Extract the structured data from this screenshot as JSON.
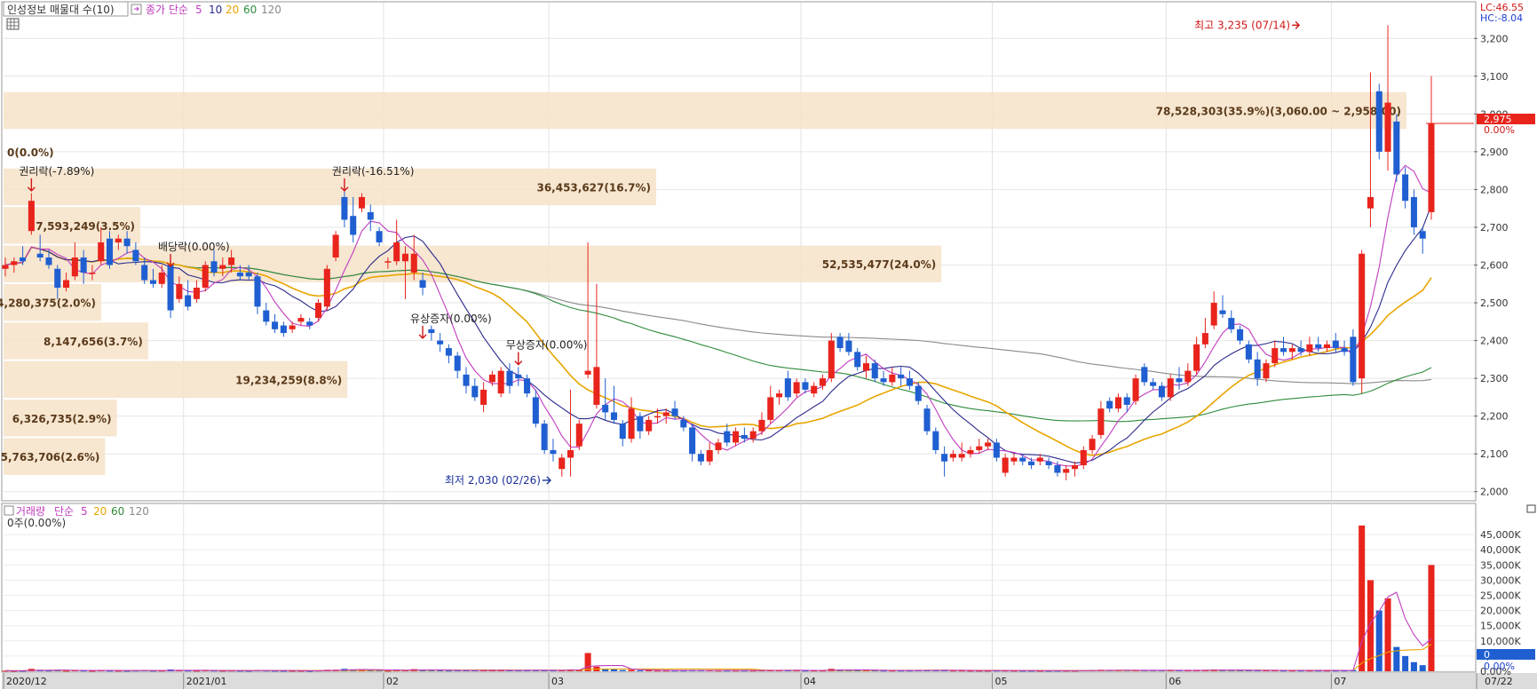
{
  "legend": {
    "title": "인성정보 매물대 수(10)",
    "price_label": "종가 단순",
    "ma_periods": [
      "5",
      "10",
      "20",
      "60",
      "120"
    ],
    "volume_label": "거래량",
    "volume_ma_label": "단순",
    "volume_ma_periods": [
      "5",
      "20",
      "60",
      "120"
    ]
  },
  "colors": {
    "up": "#e8241c",
    "down": "#1f5fd1",
    "ma5": "#c03cc0",
    "ma10": "#2a2a8c",
    "ma20": "#e8a500",
    "ma60": "#2e8b3a",
    "ma120": "#8a8a8a",
    "profile": "#f6e2c8"
  },
  "right_status": {
    "lc": "LC:46.55",
    "hc": "HC:-8.04"
  },
  "current_price_tag": "2,975",
  "current_pct_tag": "0.00%",
  "volume_current_tag": "0",
  "volume_pct_tag": "0.00%",
  "volume_info": "0주(0.00%)",
  "chart_data": {
    "type": "candlestick",
    "price_axis": {
      "ylim": [
        1990,
        3250
      ],
      "ticks": [
        2000,
        2100,
        2200,
        2300,
        2400,
        2500,
        2600,
        2700,
        2800,
        2900,
        3000,
        3100,
        3200
      ],
      "tick_labels": [
        "2,000",
        "2,100",
        "2,200",
        "2,300",
        "2,400",
        "2,500",
        "2,600",
        "2,700",
        "2,800",
        "2,900",
        "3,000",
        "3,100",
        "3,200"
      ]
    },
    "volume_axis": {
      "ylim": [
        0,
        50000
      ],
      "ticks": [
        0,
        5000,
        10000,
        15000,
        20000,
        25000,
        30000,
        35000,
        40000,
        45000
      ],
      "tick_labels": [
        "0.00%",
        "5,000K",
        "10,000K",
        "15,000K",
        "20,000K",
        "25,000K",
        "30,000K",
        "35,000K",
        "40,000K",
        "45,000K"
      ]
    },
    "x_labels": [
      "2020/12",
      "2021/01",
      "02",
      "03",
      "04",
      "05",
      "06",
      "07",
      "07/22"
    ],
    "candles": [
      [
        2590,
        2620,
        2570,
        2600,
        200
      ],
      [
        2600,
        2620,
        2580,
        2610,
        150
      ],
      [
        2620,
        2650,
        2600,
        2610,
        180
      ],
      [
        2690,
        2790,
        2680,
        2770,
        800
      ],
      [
        2630,
        2680,
        2610,
        2620,
        300
      ],
      [
        2620,
        2640,
        2590,
        2600,
        250
      ],
      [
        2590,
        2600,
        2510,
        2540,
        300
      ],
      [
        2540,
        2580,
        2530,
        2560,
        200
      ],
      [
        2570,
        2660,
        2560,
        2620,
        400
      ],
      [
        2620,
        2640,
        2550,
        2580,
        250
      ],
      [
        2580,
        2600,
        2560,
        2580,
        180
      ],
      [
        2610,
        2700,
        2600,
        2660,
        350
      ],
      [
        2670,
        2690,
        2590,
        2600,
        220
      ],
      [
        2660,
        2680,
        2640,
        2670,
        200
      ],
      [
        2670,
        2690,
        2630,
        2650,
        180
      ],
      [
        2640,
        2660,
        2600,
        2610,
        250
      ],
      [
        2600,
        2620,
        2550,
        2560,
        300
      ],
      [
        2560,
        2590,
        2540,
        2550,
        200
      ],
      [
        2550,
        2600,
        2540,
        2580,
        220
      ],
      [
        2600,
        2610,
        2460,
        2480,
        600
      ],
      [
        2510,
        2570,
        2500,
        2550,
        300
      ],
      [
        2520,
        2560,
        2480,
        2490,
        250
      ],
      [
        2510,
        2560,
        2500,
        2540,
        220
      ],
      [
        2540,
        2610,
        2530,
        2600,
        300
      ],
      [
        2610,
        2640,
        2570,
        2580,
        250
      ],
      [
        2590,
        2620,
        2570,
        2600,
        200
      ],
      [
        2600,
        2640,
        2580,
        2620,
        250
      ],
      [
        2580,
        2600,
        2560,
        2570,
        200
      ],
      [
        2580,
        2600,
        2560,
        2570,
        180
      ],
      [
        2570,
        2580,
        2470,
        2490,
        300
      ],
      [
        2480,
        2500,
        2440,
        2450,
        250
      ],
      [
        2450,
        2470,
        2420,
        2430,
        200
      ],
      [
        2440,
        2450,
        2410,
        2420,
        180
      ],
      [
        2430,
        2450,
        2420,
        2440,
        180
      ],
      [
        2450,
        2470,
        2440,
        2460,
        180
      ],
      [
        2450,
        2460,
        2430,
        2440,
        150
      ],
      [
        2460,
        2510,
        2450,
        2500,
        250
      ],
      [
        2490,
        2600,
        2480,
        2590,
        500
      ],
      [
        2620,
        2690,
        2610,
        2680,
        500
      ],
      [
        2780,
        2800,
        2700,
        2720,
        800
      ],
      [
        2730,
        2780,
        2660,
        2680,
        400
      ],
      [
        2750,
        2790,
        2740,
        2780,
        600
      ],
      [
        2740,
        2760,
        2690,
        2720,
        400
      ],
      [
        2690,
        2700,
        2650,
        2660,
        300
      ],
      [
        2610,
        2620,
        2590,
        2610,
        200
      ],
      [
        2610,
        2720,
        2600,
        2660,
        500
      ],
      [
        2610,
        2650,
        2510,
        2630,
        300
      ],
      [
        2580,
        2680,
        2560,
        2630,
        700
      ],
      [
        2560,
        2580,
        2520,
        2540,
        300
      ],
      [
        2430,
        2440,
        2400,
        2420,
        400
      ],
      [
        2400,
        2420,
        2370,
        2390,
        300
      ],
      [
        2380,
        2390,
        2340,
        2360,
        250
      ],
      [
        2360,
        2370,
        2300,
        2320,
        300
      ],
      [
        2310,
        2330,
        2260,
        2280,
        350
      ],
      [
        2280,
        2300,
        2240,
        2250,
        300
      ],
      [
        2230,
        2290,
        2210,
        2270,
        300
      ],
      [
        2290,
        2320,
        2280,
        2310,
        300
      ],
      [
        2260,
        2330,
        2250,
        2320,
        400
      ],
      [
        2320,
        2340,
        2260,
        2280,
        350
      ],
      [
        2310,
        2330,
        2280,
        2300,
        300
      ],
      [
        2300,
        2310,
        2250,
        2260,
        300
      ],
      [
        2250,
        2270,
        2170,
        2180,
        400
      ],
      [
        2180,
        2190,
        2100,
        2110,
        350
      ],
      [
        2110,
        2140,
        2080,
        2100,
        300
      ],
      [
        2060,
        2100,
        2040,
        2090,
        300
      ],
      [
        2090,
        2270,
        2040,
        2110,
        600
      ],
      [
        2120,
        2190,
        2110,
        2180,
        500
      ],
      [
        2310,
        2660,
        2300,
        2320,
        6000
      ],
      [
        2230,
        2550,
        2220,
        2330,
        1500
      ],
      [
        2230,
        2300,
        2190,
        2210,
        800
      ],
      [
        2210,
        2280,
        2180,
        2190,
        600
      ],
      [
        2180,
        2190,
        2120,
        2140,
        400
      ],
      [
        2140,
        2250,
        2130,
        2220,
        500
      ],
      [
        2200,
        2210,
        2140,
        2160,
        300
      ],
      [
        2160,
        2200,
        2150,
        2190,
        300
      ],
      [
        2200,
        2220,
        2180,
        2200,
        250
      ],
      [
        2200,
        2220,
        2180,
        2210,
        250
      ],
      [
        2220,
        2240,
        2190,
        2200,
        250
      ],
      [
        2190,
        2200,
        2160,
        2170,
        250
      ],
      [
        2170,
        2180,
        2080,
        2100,
        400
      ],
      [
        2100,
        2110,
        2070,
        2080,
        300
      ],
      [
        2080,
        2130,
        2070,
        2110,
        300
      ],
      [
        2110,
        2140,
        2100,
        2130,
        250
      ],
      [
        2160,
        2180,
        2120,
        2130,
        250
      ],
      [
        2130,
        2170,
        2120,
        2160,
        250
      ],
      [
        2150,
        2170,
        2130,
        2140,
        250
      ],
      [
        2140,
        2170,
        2130,
        2160,
        250
      ],
      [
        2160,
        2210,
        2150,
        2190,
        300
      ],
      [
        2190,
        2280,
        2180,
        2250,
        400
      ],
      [
        2250,
        2270,
        2230,
        2260,
        300
      ],
      [
        2300,
        2320,
        2240,
        2250,
        400
      ],
      [
        2260,
        2300,
        2250,
        2290,
        300
      ],
      [
        2290,
        2300,
        2260,
        2270,
        250
      ],
      [
        2260,
        2290,
        2250,
        2280,
        250
      ],
      [
        2280,
        2310,
        2270,
        2300,
        250
      ],
      [
        2300,
        2420,
        2290,
        2400,
        800
      ],
      [
        2410,
        2420,
        2370,
        2380,
        500
      ],
      [
        2400,
        2420,
        2360,
        2370,
        400
      ],
      [
        2370,
        2380,
        2320,
        2330,
        350
      ],
      [
        2320,
        2360,
        2300,
        2340,
        300
      ],
      [
        2340,
        2350,
        2290,
        2300,
        300
      ],
      [
        2300,
        2320,
        2280,
        2290,
        250
      ],
      [
        2290,
        2330,
        2280,
        2310,
        250
      ],
      [
        2310,
        2330,
        2280,
        2300,
        250
      ],
      [
        2300,
        2320,
        2270,
        2280,
        250
      ],
      [
        2280,
        2290,
        2230,
        2240,
        300
      ],
      [
        2220,
        2230,
        2150,
        2160,
        400
      ],
      [
        2160,
        2170,
        2100,
        2110,
        350
      ],
      [
        2100,
        2120,
        2040,
        2080,
        300
      ],
      [
        2090,
        2110,
        2080,
        2100,
        250
      ],
      [
        2090,
        2130,
        2080,
        2100,
        250
      ],
      [
        2100,
        2120,
        2090,
        2110,
        200
      ],
      [
        2110,
        2140,
        2100,
        2120,
        200
      ],
      [
        2120,
        2140,
        2110,
        2130,
        200
      ],
      [
        2130,
        2140,
        2080,
        2090,
        250
      ],
      [
        2050,
        2100,
        2040,
        2090,
        250
      ],
      [
        2080,
        2100,
        2070,
        2090,
        200
      ],
      [
        2090,
        2100,
        2070,
        2080,
        200
      ],
      [
        2080,
        2090,
        2060,
        2070,
        200
      ],
      [
        2080,
        2100,
        2070,
        2090,
        180
      ],
      [
        2080,
        2090,
        2060,
        2070,
        180
      ],
      [
        2070,
        2080,
        2040,
        2050,
        200
      ],
      [
        2050,
        2070,
        2030,
        2060,
        200
      ],
      [
        2060,
        2080,
        2040,
        2070,
        200
      ],
      [
        2070,
        2120,
        2060,
        2110,
        300
      ],
      [
        2110,
        2150,
        2100,
        2140,
        300
      ],
      [
        2150,
        2240,
        2140,
        2220,
        500
      ],
      [
        2240,
        2250,
        2210,
        2220,
        300
      ],
      [
        2220,
        2260,
        2210,
        2250,
        300
      ],
      [
        2250,
        2260,
        2210,
        2230,
        300
      ],
      [
        2240,
        2310,
        2230,
        2300,
        400
      ],
      [
        2330,
        2340,
        2280,
        2290,
        350
      ],
      [
        2290,
        2300,
        2270,
        2280,
        300
      ],
      [
        2280,
        2290,
        2240,
        2250,
        300
      ],
      [
        2250,
        2310,
        2240,
        2300,
        350
      ],
      [
        2300,
        2330,
        2270,
        2290,
        300
      ],
      [
        2290,
        2340,
        2280,
        2320,
        300
      ],
      [
        2320,
        2410,
        2310,
        2390,
        400
      ],
      [
        2390,
        2460,
        2380,
        2420,
        400
      ],
      [
        2440,
        2530,
        2430,
        2500,
        500
      ],
      [
        2480,
        2520,
        2460,
        2470,
        350
      ],
      [
        2460,
        2480,
        2420,
        2430,
        300
      ],
      [
        2430,
        2440,
        2390,
        2400,
        300
      ],
      [
        2390,
        2400,
        2340,
        2350,
        300
      ],
      [
        2350,
        2370,
        2280,
        2300,
        350
      ],
      [
        2300,
        2350,
        2290,
        2340,
        300
      ],
      [
        2340,
        2400,
        2330,
        2380,
        300
      ],
      [
        2380,
        2410,
        2360,
        2370,
        250
      ],
      [
        2370,
        2390,
        2350,
        2380,
        250
      ],
      [
        2380,
        2400,
        2360,
        2370,
        250
      ],
      [
        2370,
        2410,
        2360,
        2390,
        250
      ],
      [
        2390,
        2410,
        2370,
        2380,
        250
      ],
      [
        2380,
        2400,
        2370,
        2390,
        250
      ],
      [
        2400,
        2420,
        2370,
        2380,
        250
      ],
      [
        2380,
        2400,
        2360,
        2370,
        250
      ],
      [
        2410,
        2430,
        2280,
        2290,
        400
      ],
      [
        2300,
        2640,
        2260,
        2630,
        48000
      ],
      [
        2750,
        3110,
        2700,
        2780,
        30000
      ],
      [
        3060,
        3080,
        2880,
        2900,
        20000
      ],
      [
        2900,
        3235,
        2850,
        3030,
        24000
      ],
      [
        2980,
        3000,
        2820,
        2840,
        8000
      ],
      [
        2840,
        2860,
        2750,
        2770,
        5000
      ],
      [
        2780,
        2800,
        2680,
        2700,
        3000
      ],
      [
        2690,
        2700,
        2630,
        2670,
        2000
      ],
      [
        2740,
        3100,
        2720,
        2975,
        35000
      ]
    ],
    "volume_profile": [
      {
        "label": "78,528,303(35.9%)(3,060.00 ~ 2,958.00)",
        "low": 2958,
        "high": 3060
      },
      {
        "label": "36,453,627(16.7%)",
        "low": 2756,
        "high": 2858
      },
      {
        "label": "7,593,249(3.5%)",
        "low": 2654,
        "high": 2756
      },
      {
        "label": "52,535,477(24.0%)",
        "low": 2552,
        "high": 2654
      },
      {
        "label": "4,280,375(2.0%)",
        "low": 2450,
        "high": 2552
      },
      {
        "label": "8,147,656(3.7%)",
        "low": 2348,
        "high": 2450
      },
      {
        "label": "19,234,259(8.8%)",
        "low": 2246,
        "high": 2348
      },
      {
        "label": "6,326,735(2.9%)",
        "low": 2144,
        "high": 2246
      },
      {
        "label": "5,763,706(2.6%)",
        "low": 2042,
        "high": 2144
      }
    ],
    "profile_zero_label": "0(0.0%)",
    "annotations": [
      {
        "text": "권리락(-7.89%)",
        "index": 3,
        "price": 2820
      },
      {
        "text": "권리락(-16.51%)",
        "index": 39,
        "price": 2820
      },
      {
        "text": "배당락(0.00%)",
        "index": 19,
        "price": 2620
      },
      {
        "text": "유상증자(0.00%)",
        "index": 48,
        "price": 2430
      },
      {
        "text": "무상증자(0.00%)",
        "index": 59,
        "price": 2360
      }
    ],
    "high_mark": {
      "text": "최고 3,235 (07/14)",
      "price": 3235,
      "index": 149
    },
    "low_mark": {
      "text": "최저 2,030 (02/26)",
      "price": 2030,
      "index": 63
    }
  }
}
